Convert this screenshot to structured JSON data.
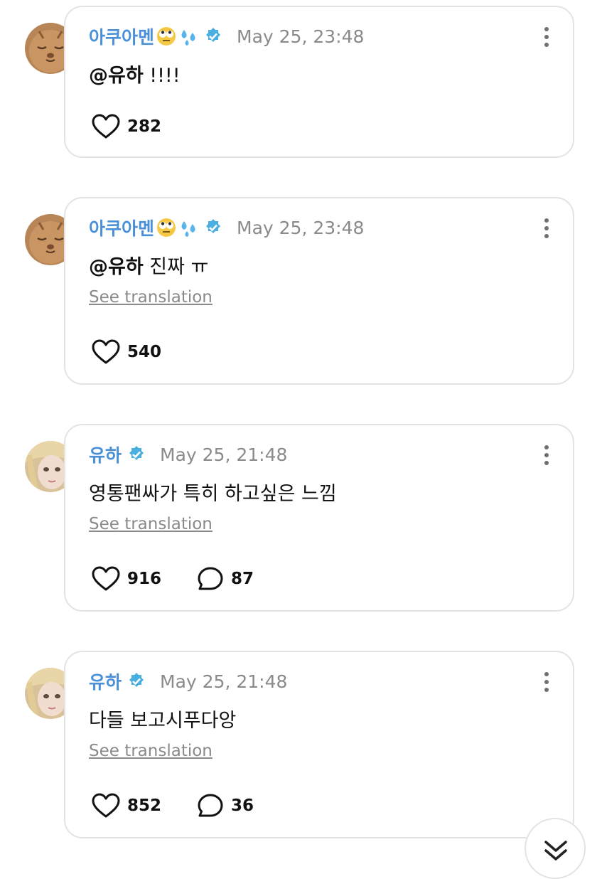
{
  "colors": {
    "name": "#4a90d9",
    "meta": "#8a8a8a",
    "border": "#e3e3e3",
    "verified": "#4aaee0"
  },
  "posts": [
    {
      "avatar": "cat-avatar",
      "name": "아쿠아멘",
      "emojis": [
        "eye-roll-face-emoji",
        "sweat-droplets-emoji"
      ],
      "time": "May 25, 23:48",
      "mention": "@유하",
      "text": " !!!!",
      "translation": "",
      "likes": "282",
      "replies": ""
    },
    {
      "avatar": "cat-avatar",
      "name": "아쿠아멘",
      "emojis": [
        "eye-roll-face-emoji",
        "sweat-droplets-emoji"
      ],
      "time": "May 25, 23:48",
      "mention": "@유하",
      "text": " 진짜 ㅠ",
      "translation": "See translation",
      "likes": "540",
      "replies": ""
    },
    {
      "avatar": "blonde-avatar",
      "name": "유하",
      "emojis": [],
      "time": "May 25, 21:48",
      "mention": "",
      "text": "영통팬싸가 특히 하고싶은 느낌",
      "translation": "See translation",
      "likes": "916",
      "replies": "87"
    },
    {
      "avatar": "blonde-avatar",
      "name": "유하",
      "emojis": [],
      "time": "May 25, 21:48",
      "mention": "",
      "text": "다들 보고시푸다앙",
      "translation": "See translation",
      "likes": "852",
      "replies": "36"
    }
  ],
  "scroll_button": {
    "icon": "double-chevron-down-icon"
  }
}
